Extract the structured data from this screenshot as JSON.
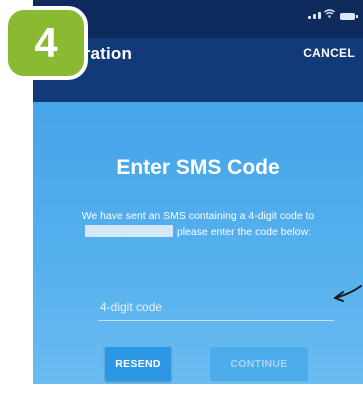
{
  "step_badge": {
    "number": "4"
  },
  "status_bar": {
    "icons": [
      "signal-icon",
      "wifi-icon",
      "battery-icon"
    ]
  },
  "app_bar": {
    "title": "egistration",
    "cancel_label": "CANCEL"
  },
  "content": {
    "heading": "Enter SMS Code",
    "message_line1": "We have sent an SMS containing a 4-digit code to",
    "message_line2": "please enter the code below:",
    "code_input": {
      "placeholder": "4-digit code",
      "value": ""
    },
    "resend_label": "RESEND",
    "continue_label": "CONTINUE"
  },
  "annotation": {
    "icon": "pointer-arrow-icon"
  },
  "colors": {
    "status_bar": "#0f2a5c",
    "app_bar": "#133a78",
    "background_top": "#3f9ee3",
    "resend_button": "#2c97e2",
    "continue_button_disabled": "#4dadea",
    "badge": "#8ab932"
  }
}
